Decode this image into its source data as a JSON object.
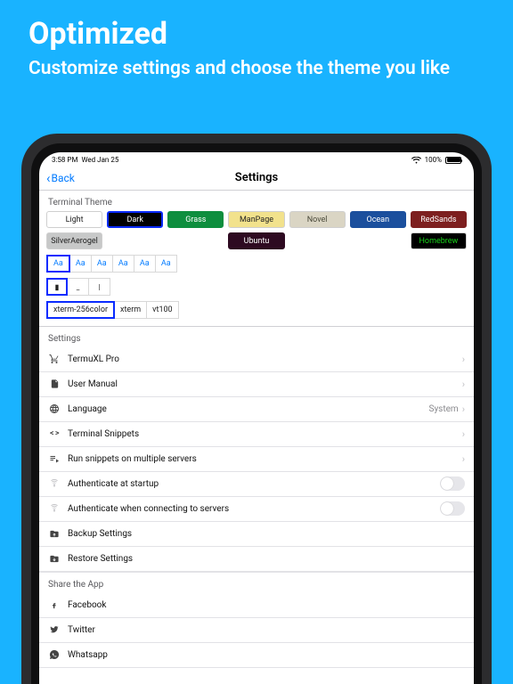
{
  "promo": {
    "title": "Optimized",
    "subtitle": "Customize settings and choose the theme you like"
  },
  "status": {
    "time": "3:58 PM",
    "date": "Wed Jan 25",
    "battery": "100%"
  },
  "nav": {
    "back": "Back",
    "title": "Settings"
  },
  "theme": {
    "header": "Terminal Theme",
    "items": [
      "Light",
      "Dark",
      "Grass",
      "ManPage",
      "Novel",
      "Ocean",
      "RedSands",
      "SilverAerogel",
      "",
      "",
      "Ubuntu",
      "",
      "",
      "Homebrew"
    ]
  },
  "font": {
    "samples": [
      "Aa",
      "Aa",
      "Aa",
      "Aa",
      "Aa",
      "Aa"
    ]
  },
  "cursor": {
    "items": [
      "▮",
      "_",
      "|"
    ]
  },
  "termtype": {
    "items": [
      "xterm-256color",
      "xterm",
      "vt100"
    ]
  },
  "settings": {
    "header": "Settings",
    "pro": "TermuXL Pro",
    "manual": "User Manual",
    "language": "Language",
    "language_value": "System",
    "snippets": "Terminal Snippets",
    "run_multi": "Run snippets on multiple servers",
    "auth_startup": "Authenticate at startup",
    "auth_connect": "Authenticate when connecting to servers",
    "backup": "Backup Settings",
    "restore": "Restore Settings"
  },
  "share": {
    "header": "Share the App",
    "facebook": "Facebook",
    "twitter": "Twitter",
    "whatsapp": "Whatsapp"
  }
}
